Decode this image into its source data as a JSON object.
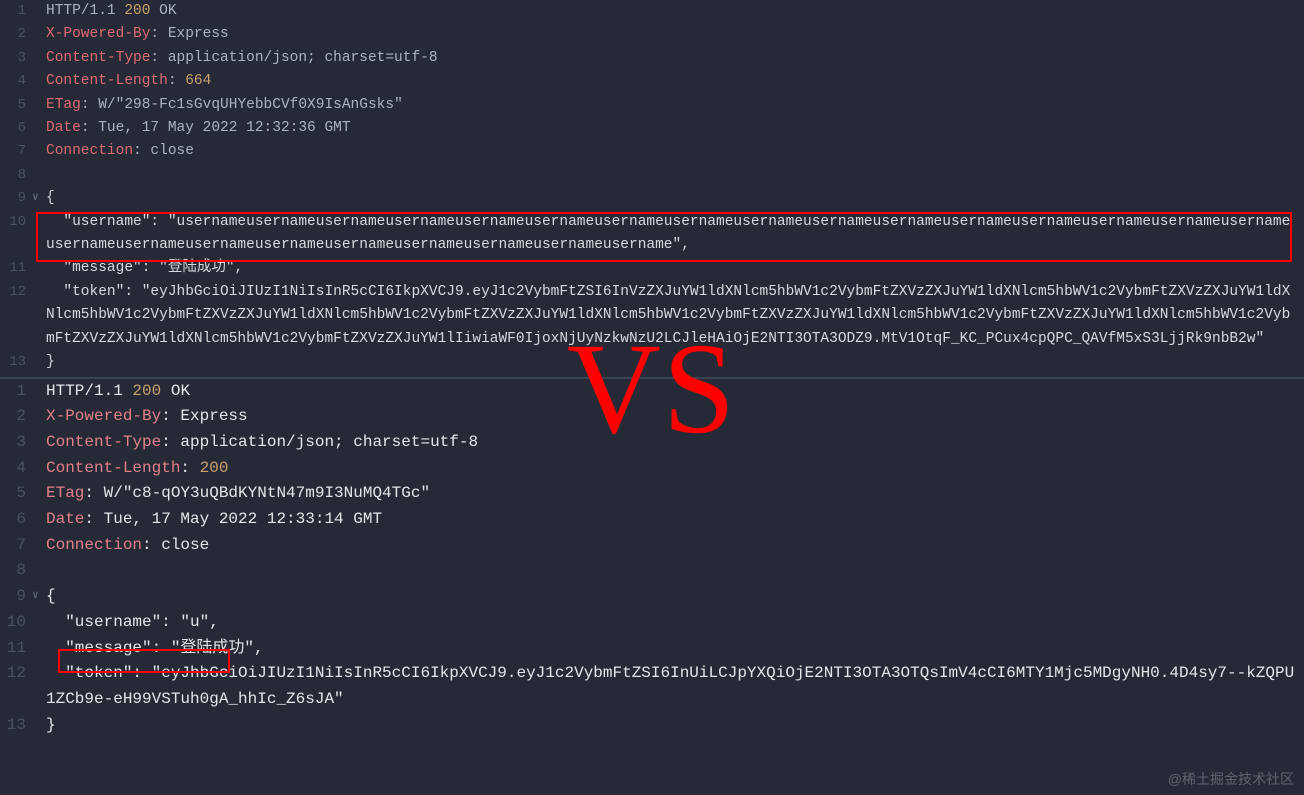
{
  "vs_label": "VS",
  "watermark": "@稀土掘金技术社区",
  "pane1": {
    "lines": [
      {
        "n": "1",
        "fold": "",
        "segs": [
          {
            "c": "k-grey",
            "t": "HTTP/1.1 "
          },
          {
            "c": "k-num",
            "t": "200"
          },
          {
            "c": "k-grey",
            "t": " OK"
          }
        ]
      },
      {
        "n": "2",
        "fold": "",
        "segs": [
          {
            "c": "k-red",
            "t": "X-Powered-By"
          },
          {
            "c": "k-grey",
            "t": ": Express"
          }
        ]
      },
      {
        "n": "3",
        "fold": "",
        "segs": [
          {
            "c": "k-red",
            "t": "Content-Type"
          },
          {
            "c": "k-grey",
            "t": ": application/json; charset=utf-8"
          }
        ]
      },
      {
        "n": "4",
        "fold": "",
        "segs": [
          {
            "c": "k-red",
            "t": "Content-Length"
          },
          {
            "c": "k-grey",
            "t": ": "
          },
          {
            "c": "k-num",
            "t": "664"
          }
        ]
      },
      {
        "n": "5",
        "fold": "",
        "segs": [
          {
            "c": "k-red",
            "t": "ETag"
          },
          {
            "c": "k-grey",
            "t": ": W/\"298-Fc1sGvqUHYebbCVf0X9IsAnGsks\""
          }
        ]
      },
      {
        "n": "6",
        "fold": "",
        "segs": [
          {
            "c": "k-red",
            "t": "Date"
          },
          {
            "c": "k-grey",
            "t": ": Tue, 17 May 2022 12:32:36 GMT"
          }
        ]
      },
      {
        "n": "7",
        "fold": "",
        "segs": [
          {
            "c": "k-red",
            "t": "Connection"
          },
          {
            "c": "k-grey",
            "t": ": close"
          }
        ]
      },
      {
        "n": "8",
        "fold": "",
        "segs": [
          {
            "c": "k-grey",
            "t": ""
          }
        ]
      },
      {
        "n": "9",
        "fold": "∨",
        "segs": [
          {
            "c": "brace",
            "t": "{"
          }
        ]
      },
      {
        "n": "10",
        "fold": "",
        "segs": [
          {
            "c": "k-light",
            "t": "  \"username\": \"usernameusernameusernameusernameusernameusernameusernameusernameusernameusernameusernameusernameusernameusernameusernameusernameusernameusernameusernameusernameusernameusernameusernameusernameusername\","
          }
        ]
      },
      {
        "n": "11",
        "fold": "",
        "segs": [
          {
            "c": "k-light",
            "t": "  \"message\": \"登陆成功\","
          }
        ]
      },
      {
        "n": "12",
        "fold": "",
        "segs": [
          {
            "c": "k-light",
            "t": "  \"token\": \"eyJhbGciOiJIUzI1NiIsInR5cCI6IkpXVCJ9.eyJ1c2VybmFtZSI6InVzZXJuYW1ldXNlcm5hbWV1c2VybmFtZXVzZXJuYW1ldXNlcm5hbWV1c2VybmFtZXVzZXJuYW1ldXNlcm5hbWV1c2VybmFtZXVzZXJuYW1ldXNlcm5hbWV1c2VybmFtZXVzZXJuYW1ldXNlcm5hbWV1c2VybmFtZXVzZXJuYW1ldXNlcm5hbWV1c2VybmFtZXVzZXJuYW1ldXNlcm5hbWV1c2VybmFtZXVzZXJuYW1ldXNlcm5hbWV1c2VybmFtZXVzZXJuYW1lIiwiaWF0IjoxNjUyNzkwNzU2LCJleHAiOjE2NTI3OTA3ODZ9.MtV1OtqF_KC_PCux4cpQPC_QAVfM5xS3LjjRk9nbB2w\""
          }
        ]
      },
      {
        "n": "13",
        "fold": "",
        "segs": [
          {
            "c": "brace",
            "t": "}"
          }
        ]
      }
    ]
  },
  "pane2": {
    "lines": [
      {
        "n": "1",
        "fold": "",
        "segs": [
          {
            "c": "k-light",
            "t": "HTTP/1.1 "
          },
          {
            "c": "k-num",
            "t": "200"
          },
          {
            "c": "k-light",
            "t": " OK"
          }
        ]
      },
      {
        "n": "2",
        "fold": "",
        "segs": [
          {
            "c": "k-red",
            "t": "X-Powered-By"
          },
          {
            "c": "k-light",
            "t": ": Express"
          }
        ]
      },
      {
        "n": "3",
        "fold": "",
        "segs": [
          {
            "c": "k-red",
            "t": "Content-Type"
          },
          {
            "c": "k-light",
            "t": ": application/json; charset=utf-8"
          }
        ]
      },
      {
        "n": "4",
        "fold": "",
        "segs": [
          {
            "c": "k-red",
            "t": "Content-Length"
          },
          {
            "c": "k-light",
            "t": ": "
          },
          {
            "c": "k-num",
            "t": "200"
          }
        ]
      },
      {
        "n": "5",
        "fold": "",
        "segs": [
          {
            "c": "k-red",
            "t": "ETag"
          },
          {
            "c": "k-light",
            "t": ": W/\"c8-qOY3uQBdKYNtN47m9I3NuMQ4TGc\""
          }
        ]
      },
      {
        "n": "6",
        "fold": "",
        "segs": [
          {
            "c": "k-red",
            "t": "Date"
          },
          {
            "c": "k-light",
            "t": ": Tue, 17 May 2022 12:33:14 GMT"
          }
        ]
      },
      {
        "n": "7",
        "fold": "",
        "segs": [
          {
            "c": "k-red",
            "t": "Connection"
          },
          {
            "c": "k-light",
            "t": ": close"
          }
        ]
      },
      {
        "n": "8",
        "fold": "",
        "segs": [
          {
            "c": "k-light",
            "t": ""
          }
        ]
      },
      {
        "n": "9",
        "fold": "∨",
        "segs": [
          {
            "c": "brace",
            "t": "{"
          }
        ]
      },
      {
        "n": "10",
        "fold": "",
        "segs": [
          {
            "c": "k-light",
            "t": "  \"username\": \"u\","
          }
        ]
      },
      {
        "n": "11",
        "fold": "",
        "segs": [
          {
            "c": "k-light",
            "t": "  \"message\": \"登陆成功\","
          }
        ]
      },
      {
        "n": "12",
        "fold": "",
        "segs": [
          {
            "c": "k-light",
            "t": "  \"token\": \"eyJhbGciOiJIUzI1NiIsInR5cCI6IkpXVCJ9.eyJ1c2VybmFtZSI6InUiLCJpYXQiOjE2NTI3OTA3OTQsImV4cCI6MTY1Mjc5MDgyNH0.4D4sy7--kZQPU1ZCb9e-eH99VSTuh0gA_hhIc_Z6sJA\""
          }
        ]
      },
      {
        "n": "13",
        "fold": "",
        "segs": [
          {
            "c": "brace",
            "t": "}"
          }
        ]
      }
    ]
  }
}
